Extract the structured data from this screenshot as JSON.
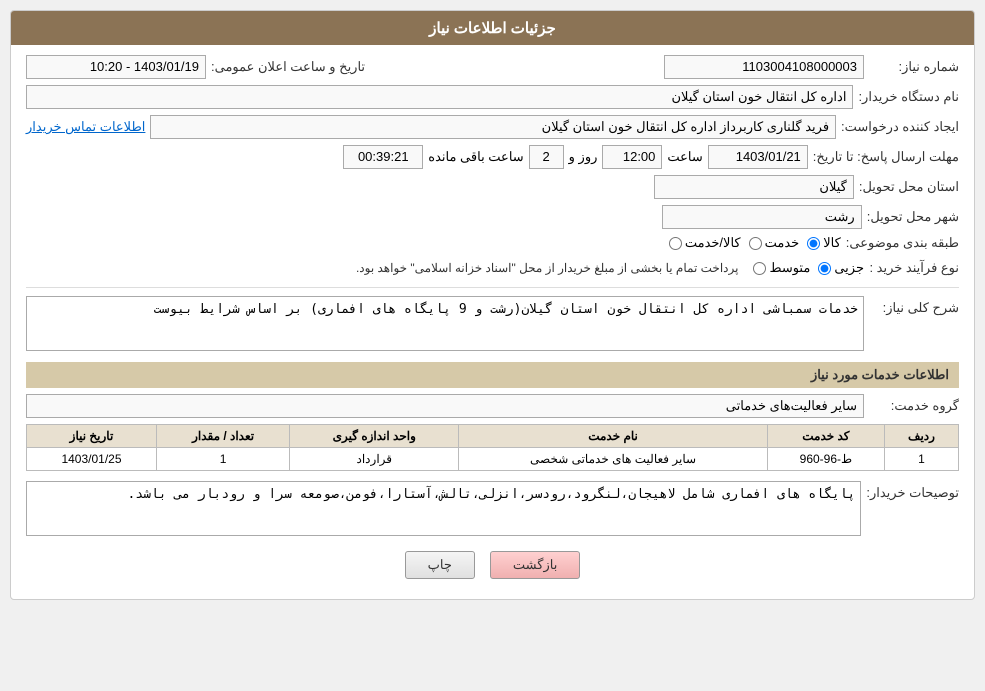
{
  "header": {
    "title": "جزئیات اطلاعات نیاز"
  },
  "fields": {
    "need_number_label": "شماره نیاز:",
    "need_number_value": "1103004108000003",
    "requester_label": "نام دستگاه خریدار:",
    "requester_value": "اداره کل انتقال خون استان گیلان",
    "announce_date_label": "تاریخ و ساعت اعلان عمومی:",
    "announce_date_value": "1403/01/19 - 10:20",
    "creator_label": "ایجاد کننده درخواست:",
    "creator_value": "فرید گلناری کاربرداز اداره کل انتقال خون استان گیلان",
    "contact_label": "اطلاعات تماس خریدار",
    "response_deadline_label": "مهلت ارسال پاسخ: تا تاریخ:",
    "response_date_value": "1403/01/21",
    "response_time_label": "ساعت",
    "response_time_value": "12:00",
    "response_days_label": "روز و",
    "response_days_value": "2",
    "remaining_label": "ساعت باقی مانده",
    "remaining_value": "00:39:21",
    "province_label": "استان محل تحویل:",
    "province_value": "گیلان",
    "city_label": "شهر محل تحویل:",
    "city_value": "رشت",
    "category_label": "طبقه بندی موضوعی:",
    "category_options": [
      "کالا",
      "خدمت",
      "کالا/خدمت"
    ],
    "category_selected": "کالا",
    "process_label": "نوع فرآیند خرید :",
    "process_options": [
      "جزیی",
      "متوسط"
    ],
    "process_note": "پرداخت تمام یا بخشی از مبلغ خریدار از محل \"اسناد خزانه اسلامی\" خواهد بود.",
    "description_section_label": "شرح کلی نیاز:",
    "description_value": "خدمات سمباشی اداره کل انتقال خون استان گیلان(رشت و 9 پایگاه های افماری) بر اساس شرایط بیوست"
  },
  "services_section": {
    "title": "اطلاعات خدمات مورد نیاز",
    "group_label": "گروه خدمت:",
    "group_value": "سایر فعالیت‌های خدماتی",
    "table": {
      "headers": [
        "ردیف",
        "کد خدمت",
        "نام خدمت",
        "واحد اندازه گیری",
        "تعداد / مقدار",
        "تاریخ نیاز"
      ],
      "rows": [
        [
          "1",
          "ط-96-960",
          "سایر فعالیت های خدماتی شخصی",
          "قرارداد",
          "1",
          "1403/01/25"
        ]
      ]
    }
  },
  "buyer_notes": {
    "label": "توصیحات خریدار:",
    "value": "پایگاه های افماری شامل لاهیجان،لنگرود،رودسر،انزلی،تالش،آستارا،فومن،صومعه سرا و رودبار می باشد."
  },
  "buttons": {
    "print_label": "چاپ",
    "back_label": "بازگشت"
  }
}
